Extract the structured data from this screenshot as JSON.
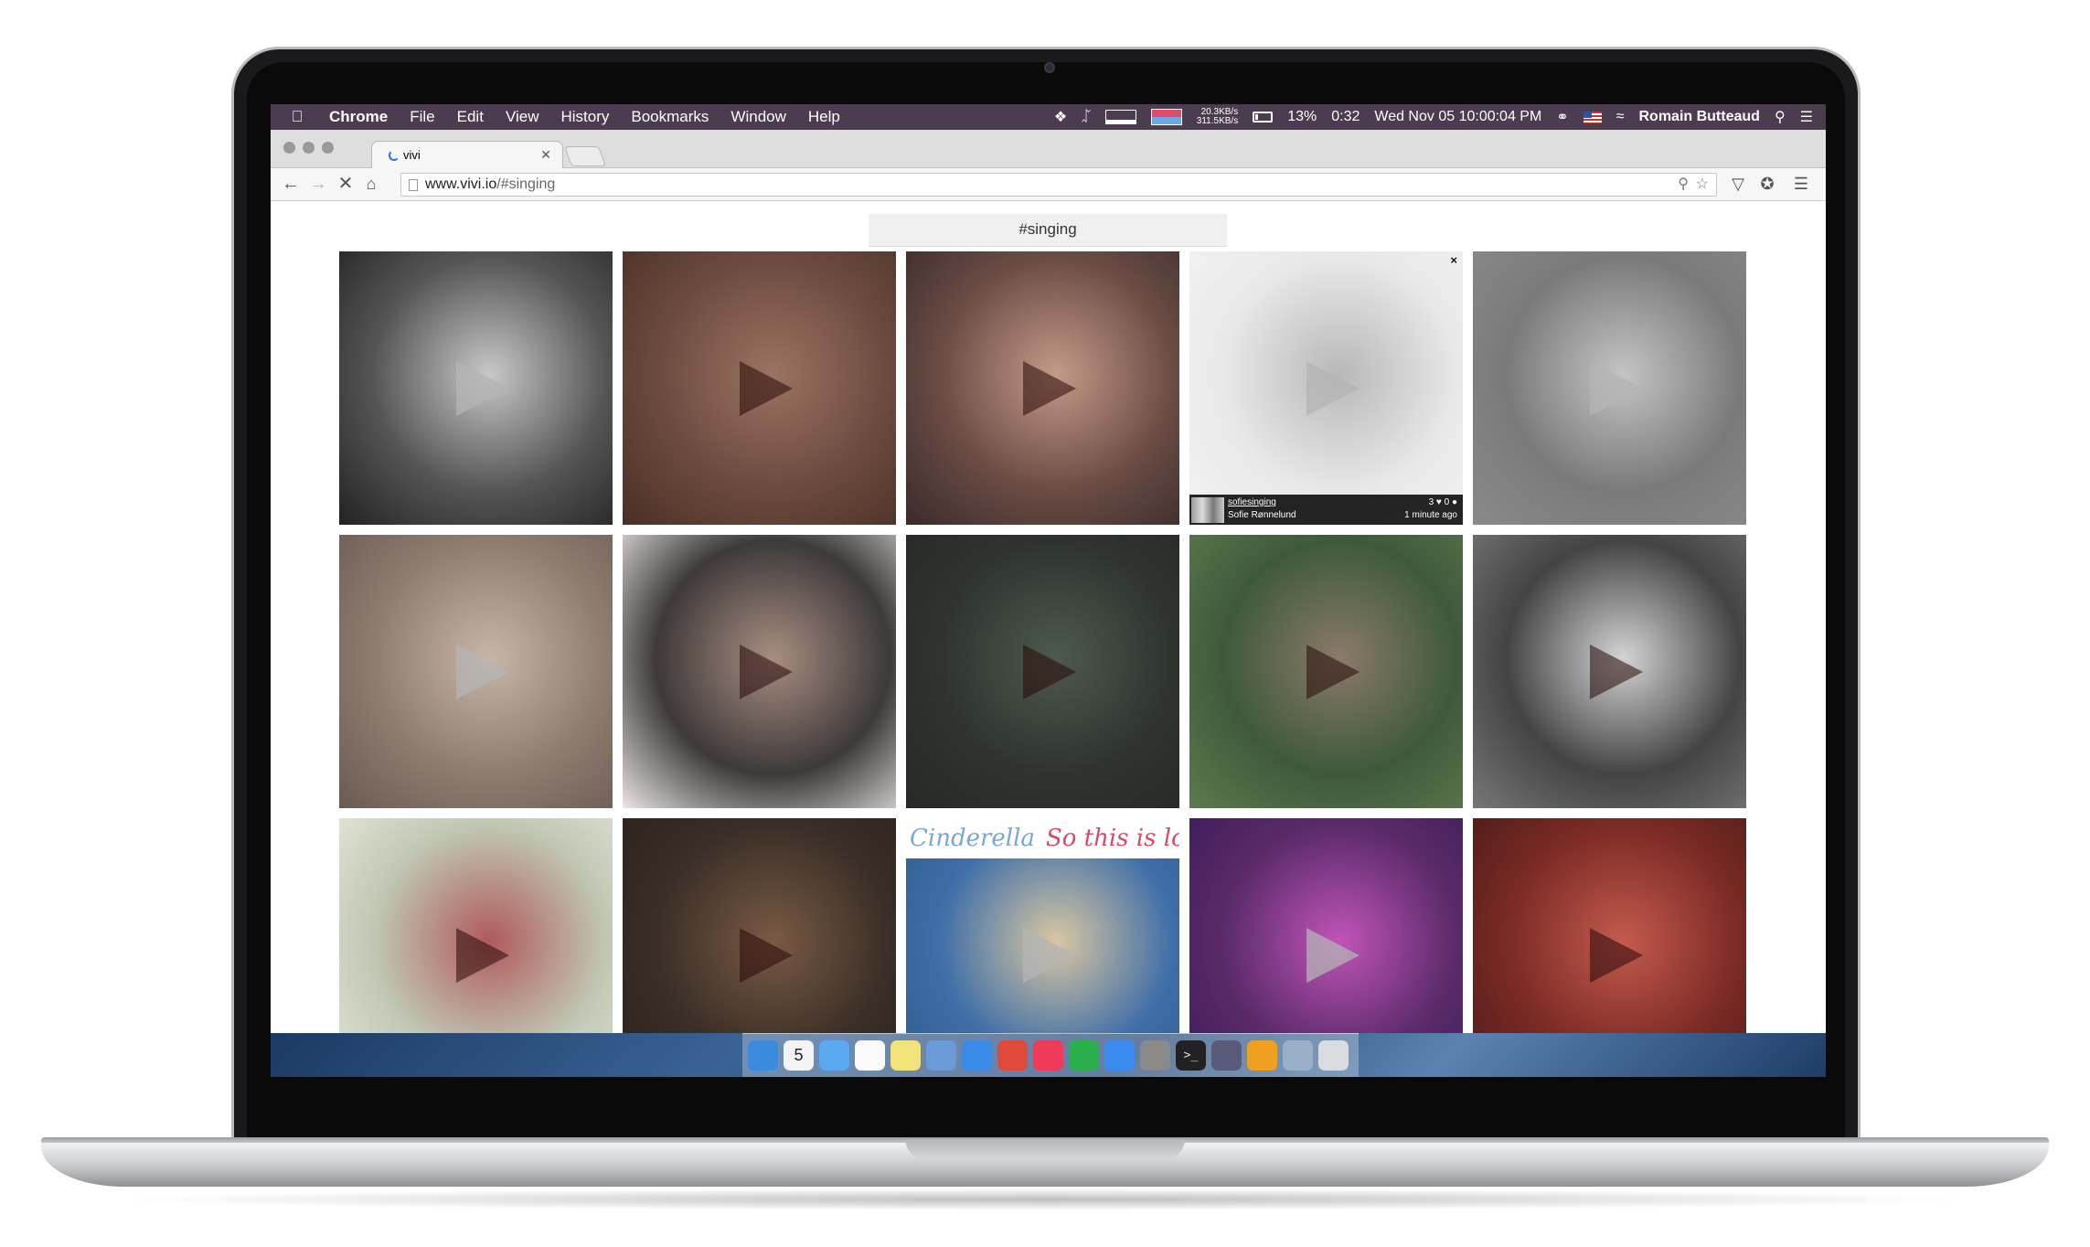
{
  "menubar": {
    "app_name": "Chrome",
    "menus": [
      "File",
      "Edit",
      "View",
      "History",
      "Bookmarks",
      "Window",
      "Help"
    ],
    "net_up": "20.3KB/s",
    "net_down": "311.5KB/s",
    "battery_percent": "13%",
    "battery_time": "0:32",
    "datetime": "Wed Nov 05 10:00:04 PM",
    "user": "Romain Butteaud"
  },
  "browser": {
    "tab_title": "vivi",
    "url_domain": "www.vivi.io",
    "url_path": "/#singing"
  },
  "page": {
    "hashtag": "#singing",
    "tiles": [
      {
        "colors": [
          "#555",
          "#c8c8c8",
          "#222"
        ],
        "play": "light"
      },
      {
        "colors": [
          "#6b4a3e",
          "#9a7462",
          "#4a2f25"
        ],
        "play": "dark"
      },
      {
        "colors": [
          "#6a4c44",
          "#c49a88",
          "#3a2a2a"
        ],
        "play": "dark"
      },
      {
        "colors": [
          "#e8e8e8",
          "#b8b8b8",
          "#f4f4f4"
        ],
        "play": "light",
        "overlay": true
      },
      {
        "colors": [
          "#7a7a7a",
          "#c4c4c4",
          "#8a8a8a"
        ],
        "play": "light"
      },
      {
        "colors": [
          "#8e7c70",
          "#c7b6a8",
          "#6a5a50"
        ],
        "play": "light"
      },
      {
        "colors": [
          "#3d3a3a",
          "#a98d80",
          "#ebe6e4"
        ],
        "play": "dark"
      },
      {
        "colors": [
          "#2e332e",
          "#4e5a4e",
          "#262a26"
        ],
        "play": "dark"
      },
      {
        "colors": [
          "#3e5a3a",
          "#8a7a6a",
          "#5c7a4e"
        ],
        "play": "dark"
      },
      {
        "colors": [
          "#444",
          "#d4d4d4",
          "#777"
        ],
        "play": "dark"
      },
      {
        "colors": [
          "#c0c8b4",
          "#b05a5a",
          "#e8e8d8"
        ],
        "play": "dark"
      },
      {
        "colors": [
          "#3a2e26",
          "#7a5a44",
          "#2a221c"
        ],
        "play": "dark"
      },
      {
        "colors": [
          "#3f6ea8",
          "#d9c7a2",
          "#2a5a8a"
        ],
        "play": "light",
        "cinderella": true
      },
      {
        "colors": [
          "#5a2a6a",
          "#c054b8",
          "#3a1a5a"
        ],
        "play": "light"
      },
      {
        "colors": [
          "#7a2a24",
          "#c45a4e",
          "#4a1a18"
        ],
        "play": "dark"
      }
    ],
    "featured_tile": {
      "username": "sofiesinging",
      "name": "Sofie Rønnelund",
      "likes": "3",
      "comments": "0",
      "time": "1 minute ago"
    },
    "cinderella_title": "Cinderella",
    "cinderella_subtitle": "So this is love"
  },
  "dock": {
    "calendar_day": "5",
    "icons": [
      {
        "name": "finder-icon",
        "color": "#3a8be0"
      },
      {
        "name": "calendar-icon",
        "color": "#f4f4f4"
      },
      {
        "name": "messages-icon",
        "color": "#5aa8f0"
      },
      {
        "name": "notes-icon",
        "color": "#fafafa"
      },
      {
        "name": "stickies-icon",
        "color": "#f2e27a"
      },
      {
        "name": "preview-icon",
        "color": "#6a9ad8"
      },
      {
        "name": "safari-icon",
        "color": "#3a8ae8"
      },
      {
        "name": "chrome-icon",
        "color": "#e04a3a"
      },
      {
        "name": "itunes-icon",
        "color": "#f03a5a"
      },
      {
        "name": "spotify-icon",
        "color": "#2ab04a"
      },
      {
        "name": "app-store-icon",
        "color": "#3a8af0"
      },
      {
        "name": "system-preferences-icon",
        "color": "#8a8a8a"
      },
      {
        "name": "terminal-icon",
        "color": "#222222"
      },
      {
        "name": "intellij-icon",
        "color": "#5a5a7a"
      },
      {
        "name": "sublime-text-icon",
        "color": "#f0a020"
      },
      {
        "name": "screenshot-icon",
        "color": "#9ab0c8"
      },
      {
        "name": "trash-icon",
        "color": "#d8dce0"
      }
    ]
  }
}
